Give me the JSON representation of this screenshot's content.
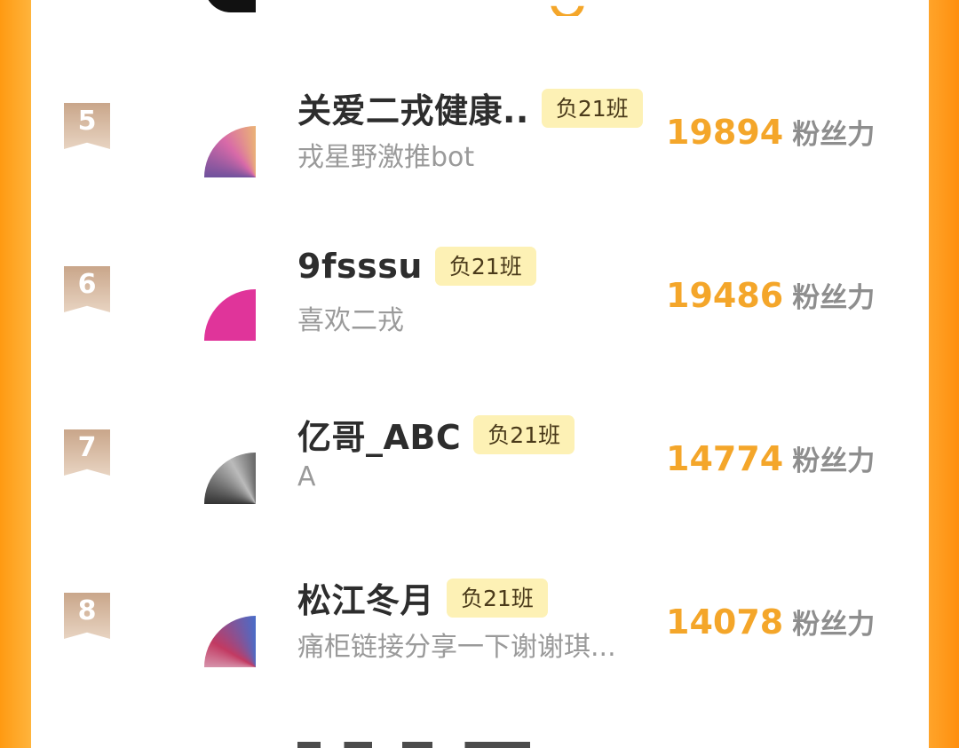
{
  "rows": [
    {
      "rank": "5",
      "name": "关爱二戎健康..",
      "badge": "负21班",
      "desc": "戎星野激推bot",
      "score": "19894",
      "unit": "粉丝力"
    },
    {
      "rank": "6",
      "name": "9fsssu",
      "badge": "负21班",
      "desc": "喜欢二戎",
      "score": "19486",
      "unit": "粉丝力"
    },
    {
      "rank": "7",
      "name": "亿哥_ABC",
      "badge": "负21班",
      "desc": "A",
      "score": "14774",
      "unit": "粉丝力"
    },
    {
      "rank": "8",
      "name": "松江冬月",
      "badge": "负21班",
      "desc": "痛柜链接分享一下谢谢琪...",
      "score": "14078",
      "unit": "粉丝力"
    }
  ],
  "colors": {
    "accent_orange": "#ff9a12",
    "score": "#f4a62a",
    "badge_bg": "#fdf1b5",
    "rank_badge": "#c9a68a"
  }
}
